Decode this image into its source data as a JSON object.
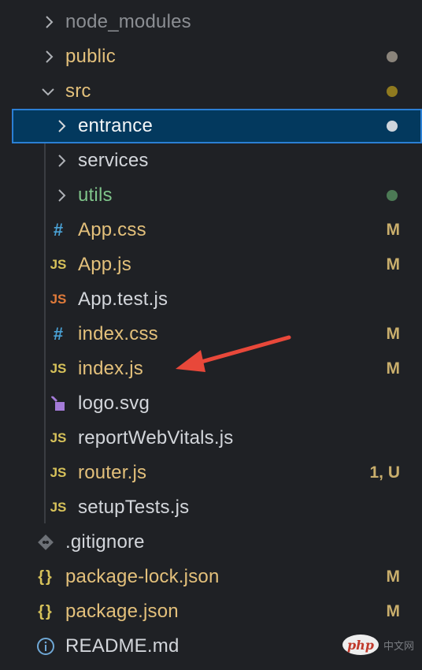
{
  "explorer": {
    "items": [
      {
        "label": "node_modules",
        "kind": "folder",
        "open": false,
        "status": "",
        "dot": "",
        "state": "ignored"
      },
      {
        "label": "public",
        "kind": "folder",
        "open": false,
        "status": "",
        "dot": "#8a847b",
        "state": "modified"
      },
      {
        "label": "src",
        "kind": "folder",
        "open": true,
        "status": "",
        "dot": "#8f7a1f",
        "state": "modified"
      },
      {
        "label": "entrance",
        "kind": "folder",
        "open": false,
        "status": "",
        "dot": "#cfd5dc",
        "state": "selected"
      },
      {
        "label": "services",
        "kind": "folder",
        "open": false,
        "status": "",
        "dot": "",
        "state": "default"
      },
      {
        "label": "utils",
        "kind": "folder",
        "open": false,
        "status": "",
        "dot": "#4c7a55",
        "state": "untracked"
      },
      {
        "label": "App.css",
        "kind": "file",
        "icon": "css-icon",
        "status": "M",
        "state": "modified"
      },
      {
        "label": "App.js",
        "kind": "file",
        "icon": "js-icon",
        "status": "M",
        "state": "modified"
      },
      {
        "label": "App.test.js",
        "kind": "file",
        "icon": "js-test-icon",
        "status": "",
        "state": "default"
      },
      {
        "label": "index.css",
        "kind": "file",
        "icon": "css-icon",
        "status": "M",
        "state": "modified"
      },
      {
        "label": "index.js",
        "kind": "file",
        "icon": "js-icon",
        "status": "M",
        "state": "modified"
      },
      {
        "label": "logo.svg",
        "kind": "file",
        "icon": "svg-icon",
        "status": "",
        "state": "default"
      },
      {
        "label": "reportWebVitals.js",
        "kind": "file",
        "icon": "js-icon",
        "status": "",
        "state": "default"
      },
      {
        "label": "router.js",
        "kind": "file",
        "icon": "js-icon",
        "status": "1, U",
        "state": "modified"
      },
      {
        "label": "setupTests.js",
        "kind": "file",
        "icon": "js-icon",
        "status": "",
        "state": "default"
      },
      {
        "label": ".gitignore",
        "kind": "file",
        "icon": "git-icon",
        "status": "",
        "state": "default"
      },
      {
        "label": "package-lock.json",
        "kind": "file",
        "icon": "json-icon",
        "status": "M",
        "state": "modified"
      },
      {
        "label": "package.json",
        "kind": "file",
        "icon": "json-icon",
        "status": "M",
        "state": "modified"
      },
      {
        "label": "README.md",
        "kind": "file",
        "icon": "info-icon",
        "status": "",
        "state": "default"
      }
    ]
  },
  "watermark": {
    "logo": "php",
    "text": "中文网"
  },
  "colors": {
    "background": "#1f2125",
    "selection": "#03395e",
    "selection_border": "#2b7fd4",
    "modified": "#e3c07b",
    "untracked": "#7fc48a",
    "ignored": "#8b8e93",
    "arrow": "#e8483a"
  }
}
